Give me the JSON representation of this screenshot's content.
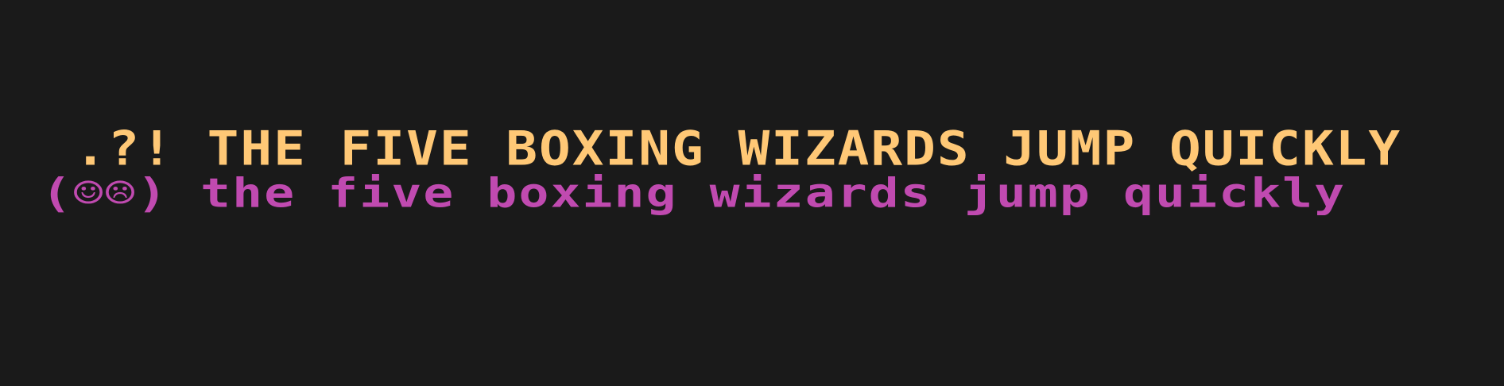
{
  "colors": {
    "background": "#1a1a1a",
    "upper_text": "#ffc876",
    "lower_text": "#c04ab0"
  },
  "font_sample": {
    "upper_line": " .?! THE FIVE BOXING WIZARDS JUMP QUICKLY",
    "lower_line": "(☺☹) the five boxing wizards jump quickly"
  }
}
